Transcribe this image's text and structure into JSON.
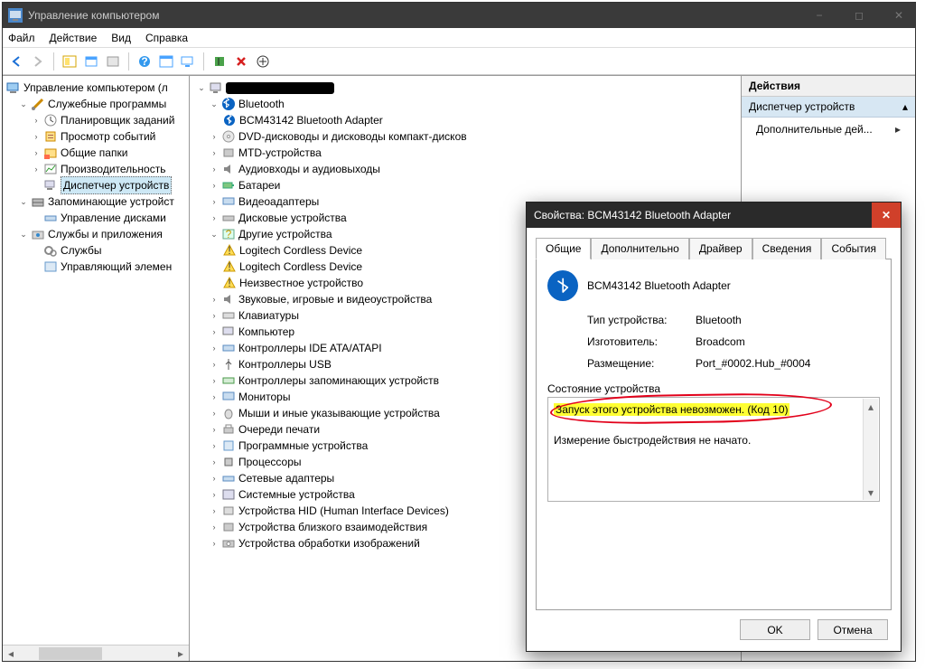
{
  "window": {
    "title": "Управление компьютером",
    "controls": {
      "min": "−",
      "max": "◻",
      "close": "✕"
    }
  },
  "menubar": [
    "Файл",
    "Действие",
    "Вид",
    "Справка"
  ],
  "left_tree": {
    "root": "Управление компьютером (л",
    "groups": [
      {
        "label": "Служебные программы",
        "children": [
          "Планировщик заданий",
          "Просмотр событий",
          "Общие папки",
          "Производительность",
          "Диспетчер устройств"
        ],
        "selected": 4
      },
      {
        "label": "Запоминающие устройст",
        "children": [
          "Управление дисками"
        ]
      },
      {
        "label": "Службы и приложения",
        "children": [
          "Службы",
          "Управляющий элемен"
        ]
      }
    ]
  },
  "device_tree": {
    "bluetooth": {
      "label": "Bluetooth",
      "child": "BCM43142 Bluetooth Adapter"
    },
    "categories": [
      "DVD-дисководы и дисководы компакт-дисков",
      "MTD-устройства",
      "Аудиовходы и аудиовыходы",
      "Батареи",
      "Видеоадаптеры",
      "Дисковые устройства"
    ],
    "other": {
      "label": "Другие устройства",
      "children": [
        "Logitech Cordless Device",
        "Logitech Cordless Device",
        "Неизвестное устройство"
      ]
    },
    "categories2": [
      "Звуковые, игровые и видеоустройства",
      "Клавиатуры",
      "Компьютер",
      "Контроллеры IDE ATA/ATAPI",
      "Контроллеры USB",
      "Контроллеры запоминающих устройств",
      "Мониторы",
      "Мыши и иные указывающие устройства",
      "Очереди печати",
      "Программные устройства",
      "Процессоры",
      "Сетевые адаптеры",
      "Системные устройства",
      "Устройства HID (Human Interface Devices)",
      "Устройства близкого взаимодействия",
      "Устройства обработки изображений"
    ]
  },
  "actions": {
    "header": "Действия",
    "section": "Диспетчер устройств",
    "item": "Дополнительные дей..."
  },
  "dialog": {
    "title": "Свойства: BCM43142 Bluetooth Adapter",
    "tabs": [
      "Общие",
      "Дополнительно",
      "Драйвер",
      "Сведения",
      "События"
    ],
    "device_name": "BCM43142 Bluetooth Adapter",
    "kv": {
      "type_label": "Тип устройства:",
      "type_value": "Bluetooth",
      "mfr_label": "Изготовитель:",
      "mfr_value": "Broadcom",
      "loc_label": "Размещение:",
      "loc_value": "Port_#0002.Hub_#0004"
    },
    "status_label": "Состояние устройства",
    "status_line1": "Запуск этого устройства невозможен. (Код 10)",
    "status_line2": "Измерение быстродействия не начато.",
    "ok": "OK",
    "cancel": "Отмена"
  }
}
